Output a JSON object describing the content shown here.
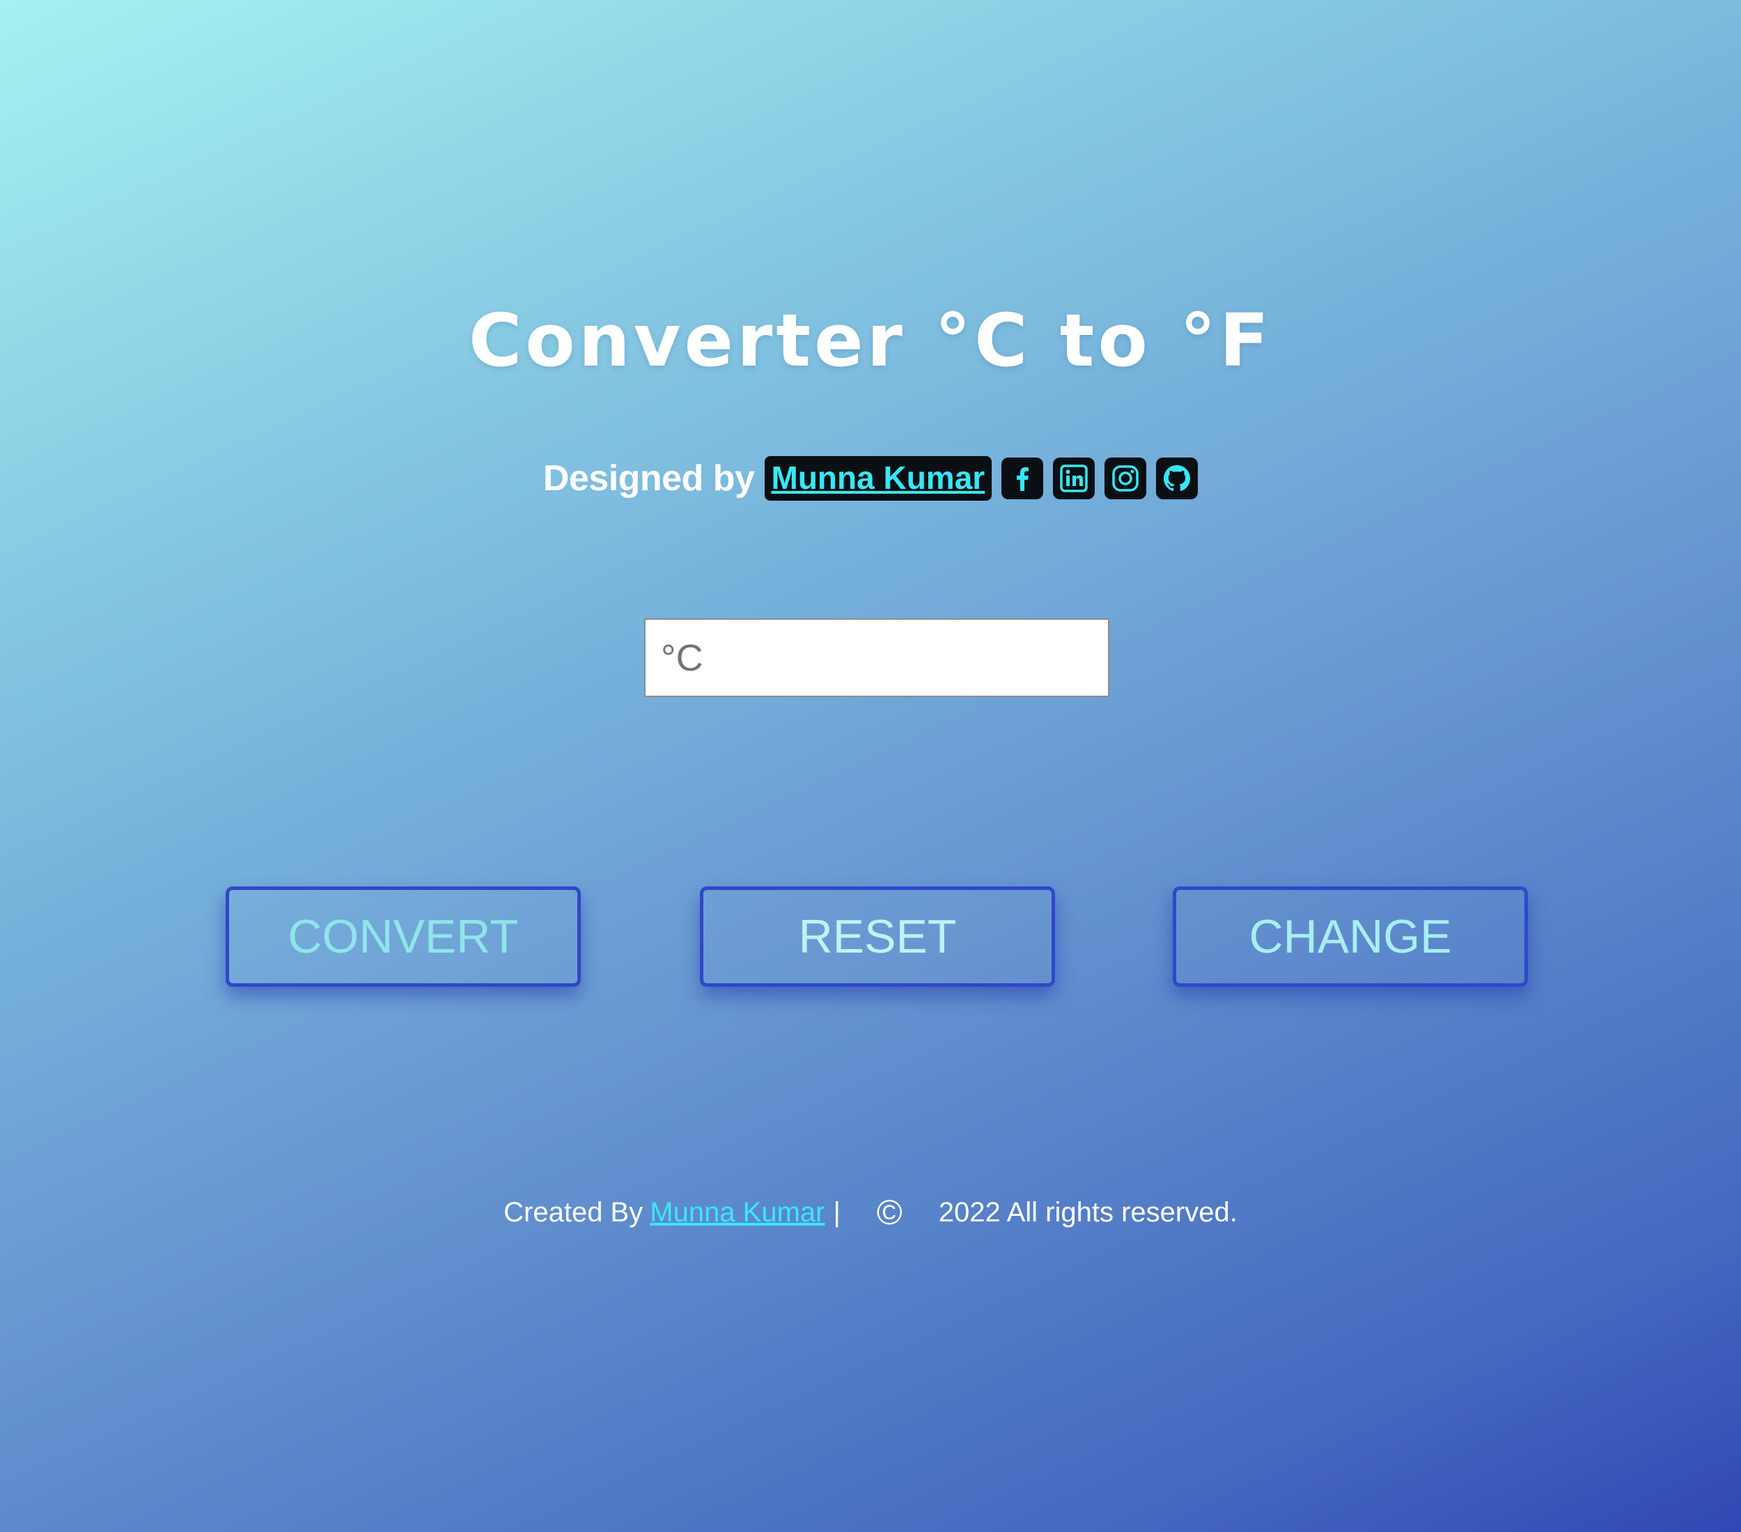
{
  "header": {
    "title": "Converter °C to °F"
  },
  "credit": {
    "designed_by": "Designed by",
    "author_name": "Munna Kumar",
    "social_icons": [
      "facebook-icon",
      "linkedin-icon",
      "instagram-icon",
      "github-icon"
    ]
  },
  "converter": {
    "input_placeholder": "°C",
    "input_value": ""
  },
  "buttons": {
    "convert": "CONVERT",
    "reset": "RESET",
    "change": "CHANGE"
  },
  "footer": {
    "created_by": "Created By",
    "author_name": "Munna Kumar",
    "separator": "|",
    "copyright_symbol": "©",
    "rights_text": "2022 All rights reserved."
  },
  "colors": {
    "background_start": "#a4f2f1",
    "background_end": "#3048b4",
    "accent_cyan": "#35e8f4",
    "button_border": "#2f48c8",
    "badge_background": "#0a0f14"
  }
}
